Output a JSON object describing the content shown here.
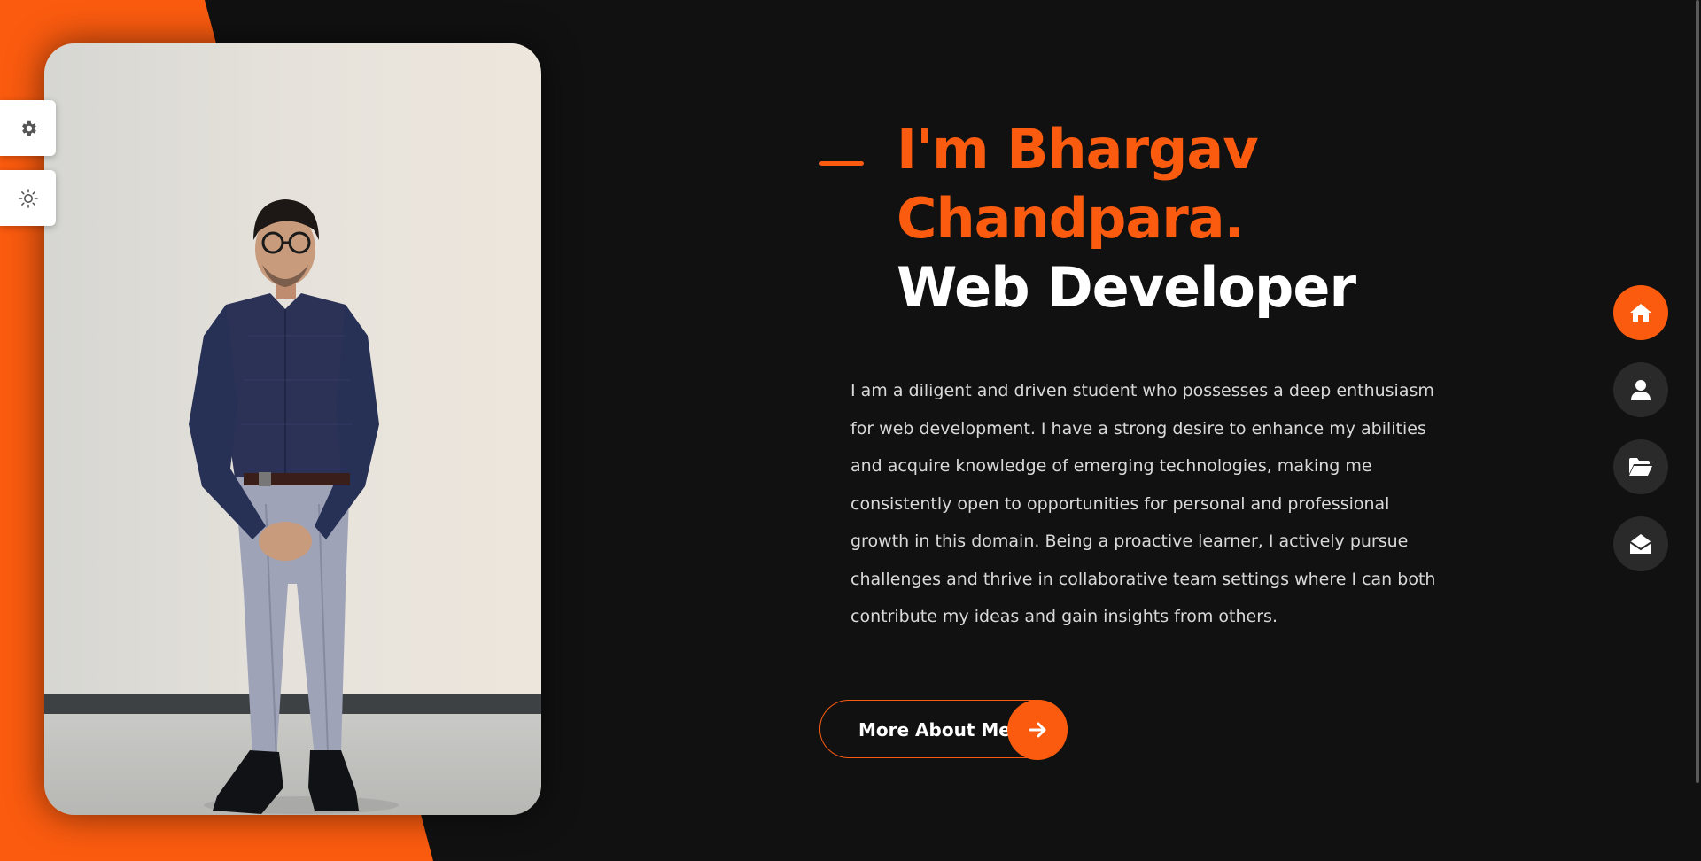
{
  "hero": {
    "name_line1": "I'm Bhargav",
    "name_line2": "Chandpara.",
    "role": "Web Developer",
    "description": "I am a diligent and driven student who possesses a deep enthusiasm for web development. I have a strong desire to enhance my abilities and acquire knowledge of emerging technologies, making me consistently open to opportunities for personal and professional growth in this domain. Being a proactive learner, I actively pursue challenges and thrive in collaborative team settings where I can both contribute my ideas and gain insights from others.",
    "button_label": "More About Me",
    "button_icon": "arrow-right-icon"
  },
  "side_tools": [
    {
      "name": "settings",
      "icon": "gear-icon"
    },
    {
      "name": "theme-toggle",
      "icon": "sun-icon"
    }
  ],
  "nav": [
    {
      "name": "home",
      "icon": "home-icon",
      "active": true
    },
    {
      "name": "about",
      "icon": "user-icon",
      "active": false
    },
    {
      "name": "portfolio",
      "icon": "folder-open-icon",
      "active": false
    },
    {
      "name": "contact",
      "icon": "envelope-open-icon",
      "active": false
    }
  ],
  "colors": {
    "accent": "#fa5b0f",
    "background": "#111111",
    "nav_inactive": "#2b2a2a",
    "text_light": "#ffffff",
    "text_body": "#d9d9d9"
  }
}
